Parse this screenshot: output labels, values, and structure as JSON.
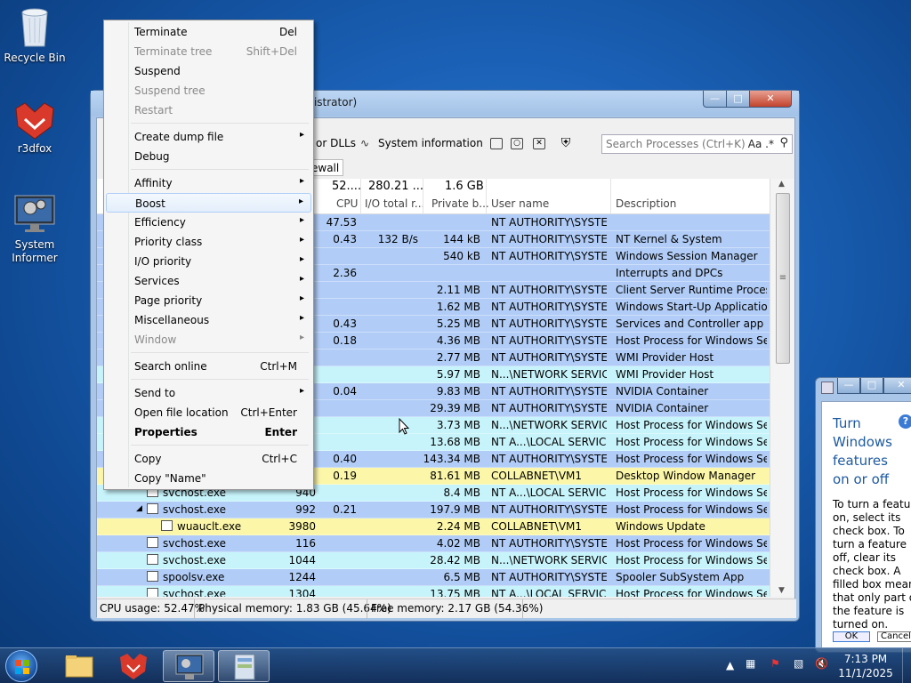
{
  "desktop": {
    "icons": [
      {
        "label": "Recycle Bin"
      },
      {
        "label": "r3dfox"
      },
      {
        "label": "System\nInformer"
      }
    ]
  },
  "window": {
    "title_fragment": "inistrator)",
    "toolbar": {
      "dlls_label": "or DLLs",
      "sysinfo_label": "System information",
      "search_placeholder": "Search Processes (Ctrl+K)",
      "search_opts": "Aa .*"
    },
    "tab_fragment": "ewall",
    "header": {
      "cpu_total": "52....",
      "io_total": "280.21 ...",
      "priv_total": "1.6 GB",
      "columns": {
        "cpu": "CPU",
        "io": "I/O total r...",
        "priv": "Private b...",
        "user": "User name",
        "desc": "Description"
      }
    },
    "rows": [
      {
        "name": "",
        "pid": "",
        "cpu": "47.53",
        "io": "",
        "priv": "",
        "user": "NT AUTHORITY\\SYSTEM",
        "desc": "",
        "color": "#b1cdf7"
      },
      {
        "name": "",
        "pid": "",
        "cpu": "0.43",
        "io": "132 B/s",
        "priv": "144 kB",
        "user": "NT AUTHORITY\\SYSTEM",
        "desc": "NT Kernel & System",
        "color": "#b1cdf7"
      },
      {
        "name": "",
        "pid": "",
        "cpu": "",
        "io": "",
        "priv": "540 kB",
        "user": "NT AUTHORITY\\SYSTEM",
        "desc": "Windows Session Manager",
        "color": "#b1cdf7"
      },
      {
        "name": "",
        "pid": "",
        "cpu": "2.36",
        "io": "",
        "priv": "",
        "user": "",
        "desc": "Interrupts and DPCs",
        "color": "#b1cdf7"
      },
      {
        "name": "",
        "pid": "",
        "cpu": "",
        "io": "",
        "priv": "2.11 MB",
        "user": "NT AUTHORITY\\SYSTEM",
        "desc": "Client Server Runtime Process",
        "color": "#b1cdf7"
      },
      {
        "name": "",
        "pid": "",
        "cpu": "",
        "io": "",
        "priv": "1.62 MB",
        "user": "NT AUTHORITY\\SYSTEM",
        "desc": "Windows Start-Up Application",
        "color": "#b1cdf7"
      },
      {
        "name": "",
        "pid": "",
        "cpu": "0.43",
        "io": "",
        "priv": "5.25 MB",
        "user": "NT AUTHORITY\\SYSTEM",
        "desc": "Services and Controller app",
        "color": "#b1cdf7"
      },
      {
        "name": "",
        "pid": "",
        "cpu": "0.18",
        "io": "",
        "priv": "4.36 MB",
        "user": "NT AUTHORITY\\SYSTEM",
        "desc": "Host Process for Windows Ser...",
        "color": "#b1cdf7"
      },
      {
        "name": "",
        "pid": "",
        "cpu": "",
        "io": "",
        "priv": "2.77 MB",
        "user": "NT AUTHORITY\\SYSTEM",
        "desc": "WMI Provider Host",
        "color": "#b1cdf7"
      },
      {
        "name": "",
        "pid": "",
        "cpu": "",
        "io": "",
        "priv": "5.97 MB",
        "user": "N...\\NETWORK SERVICE",
        "desc": "WMI Provider Host",
        "color": "#c7f4fb"
      },
      {
        "name": "",
        "pid": "",
        "cpu": "0.04",
        "io": "",
        "priv": "9.83 MB",
        "user": "NT AUTHORITY\\SYSTEM",
        "desc": "NVIDIA Container",
        "color": "#b1cdf7"
      },
      {
        "name": "",
        "pid": "",
        "cpu": "",
        "io": "",
        "priv": "29.39 MB",
        "user": "NT AUTHORITY\\SYSTEM",
        "desc": "NVIDIA Container",
        "color": "#b1cdf7"
      },
      {
        "name": "",
        "pid": "",
        "cpu": "",
        "io": "",
        "priv": "3.73 MB",
        "user": "N...\\NETWORK SERVICE",
        "desc": "Host Process for Windows Ser...",
        "color": "#c7f4fb"
      },
      {
        "name": "",
        "pid": "",
        "cpu": "",
        "io": "",
        "priv": "13.68 MB",
        "user": "NT A...\\LOCAL SERVICE",
        "desc": "Host Process for Windows Ser...",
        "color": "#c7f4fb"
      },
      {
        "name": "",
        "pid": "",
        "cpu": "0.40",
        "io": "",
        "priv": "143.34 MB",
        "user": "NT AUTHORITY\\SYSTEM",
        "desc": "Host Process for Windows Ser...",
        "color": "#b1cdf7"
      },
      {
        "name": "",
        "pid": "",
        "cpu": "0.19",
        "io": "",
        "priv": "81.61 MB",
        "user": "COLLABNET\\VM1",
        "desc": "Desktop Window Manager",
        "color": "#fbf6a8"
      },
      {
        "name": "svchost.exe",
        "pid": "940",
        "cpu": "",
        "io": "",
        "priv": "8.4 MB",
        "user": "NT A...\\LOCAL SERVICE",
        "desc": "Host Process for Windows Ser...",
        "color": "#c7f4fb"
      },
      {
        "name": "svchost.exe",
        "pid": "992",
        "cpu": "0.21",
        "io": "",
        "priv": "197.9 MB",
        "user": "NT AUTHORITY\\SYSTEM",
        "desc": "Host Process for Windows Ser...",
        "color": "#b1cdf7"
      },
      {
        "name": "wuauclt.exe",
        "pid": "3980",
        "cpu": "",
        "io": "",
        "priv": "2.24 MB",
        "user": "COLLABNET\\VM1",
        "desc": "Windows Update",
        "color": "#fbf6a8"
      },
      {
        "name": "svchost.exe",
        "pid": "116",
        "cpu": "",
        "io": "",
        "priv": "4.02 MB",
        "user": "NT AUTHORITY\\SYSTEM",
        "desc": "Host Process for Windows Ser...",
        "color": "#b1cdf7"
      },
      {
        "name": "svchost.exe",
        "pid": "1044",
        "cpu": "",
        "io": "",
        "priv": "28.42 MB",
        "user": "N...\\NETWORK SERVICE",
        "desc": "Host Process for Windows Ser...",
        "color": "#c7f4fb"
      },
      {
        "name": "spoolsv.exe",
        "pid": "1244",
        "cpu": "",
        "io": "",
        "priv": "6.5 MB",
        "user": "NT AUTHORITY\\SYSTEM",
        "desc": "Spooler SubSystem App",
        "color": "#b1cdf7"
      },
      {
        "name": "svchost.exe",
        "pid": "1304",
        "cpu": "",
        "io": "",
        "priv": "13.75 MB",
        "user": "NT A...\\LOCAL SERVICE",
        "desc": "Host Process for Windows Ser...",
        "color": "#c7f4fb"
      }
    ],
    "status": {
      "cpu": "CPU usage: 52.47%",
      "phys": "Physical memory: 1.83 GB (45.64%)",
      "free": "Free memory: 2.17 GB (54.36%)"
    }
  },
  "context_menu": {
    "items": [
      {
        "label": "Terminate",
        "shortcut": "Del",
        "submenu": false,
        "disabled": false,
        "bold": false
      },
      {
        "label": "Terminate tree",
        "shortcut": "Shift+Del",
        "submenu": false,
        "disabled": true,
        "bold": false
      },
      {
        "label": "Suspend",
        "shortcut": "",
        "submenu": false,
        "disabled": false,
        "bold": false
      },
      {
        "label": "Suspend tree",
        "shortcut": "",
        "submenu": false,
        "disabled": true,
        "bold": false
      },
      {
        "label": "Restart",
        "shortcut": "",
        "submenu": false,
        "disabled": true,
        "bold": false
      },
      {
        "sep": true
      },
      {
        "label": "Create dump file",
        "shortcut": "",
        "submenu": true,
        "disabled": false,
        "bold": false
      },
      {
        "label": "Debug",
        "shortcut": "",
        "submenu": false,
        "disabled": false,
        "bold": false
      },
      {
        "sep": true
      },
      {
        "label": "Affinity",
        "shortcut": "",
        "submenu": true,
        "disabled": false,
        "bold": false
      },
      {
        "label": "Boost",
        "shortcut": "",
        "submenu": true,
        "disabled": false,
        "bold": false,
        "highlight": true
      },
      {
        "label": "Efficiency",
        "shortcut": "",
        "submenu": true,
        "disabled": false,
        "bold": false
      },
      {
        "label": "Priority class",
        "shortcut": "",
        "submenu": true,
        "disabled": false,
        "bold": false
      },
      {
        "label": "I/O priority",
        "shortcut": "",
        "submenu": true,
        "disabled": false,
        "bold": false
      },
      {
        "label": "Services",
        "shortcut": "",
        "submenu": true,
        "disabled": false,
        "bold": false
      },
      {
        "label": "Page priority",
        "shortcut": "",
        "submenu": true,
        "disabled": false,
        "bold": false
      },
      {
        "label": "Miscellaneous",
        "shortcut": "",
        "submenu": true,
        "disabled": false,
        "bold": false
      },
      {
        "label": "Window",
        "shortcut": "",
        "submenu": true,
        "disabled": true,
        "bold": false
      },
      {
        "sep": true
      },
      {
        "label": "Search online",
        "shortcut": "Ctrl+M",
        "submenu": false,
        "disabled": false,
        "bold": false
      },
      {
        "sep": true
      },
      {
        "label": "Send to",
        "shortcut": "",
        "submenu": true,
        "disabled": false,
        "bold": false
      },
      {
        "label": "Open file location",
        "shortcut": "Ctrl+Enter",
        "submenu": false,
        "disabled": false,
        "bold": false
      },
      {
        "label": "Properties",
        "shortcut": "Enter",
        "submenu": false,
        "disabled": false,
        "bold": true
      },
      {
        "sep": true
      },
      {
        "label": "Copy",
        "shortcut": "Ctrl+C",
        "submenu": false,
        "disabled": false,
        "bold": false
      },
      {
        "label": "Copy \"Name\"",
        "shortcut": "",
        "submenu": false,
        "disabled": false,
        "bold": false
      }
    ]
  },
  "side_window": {
    "heading": "Turn Windows features on or off",
    "body": "To turn a feature on, select its check box. To turn a feature off, clear its check box. A filled box means that only part of the feature is turned on.",
    "ok": "OK",
    "cancel": "Cancel"
  },
  "taskbar": {
    "time": "7:13 PM",
    "date": "11/1/2025"
  }
}
